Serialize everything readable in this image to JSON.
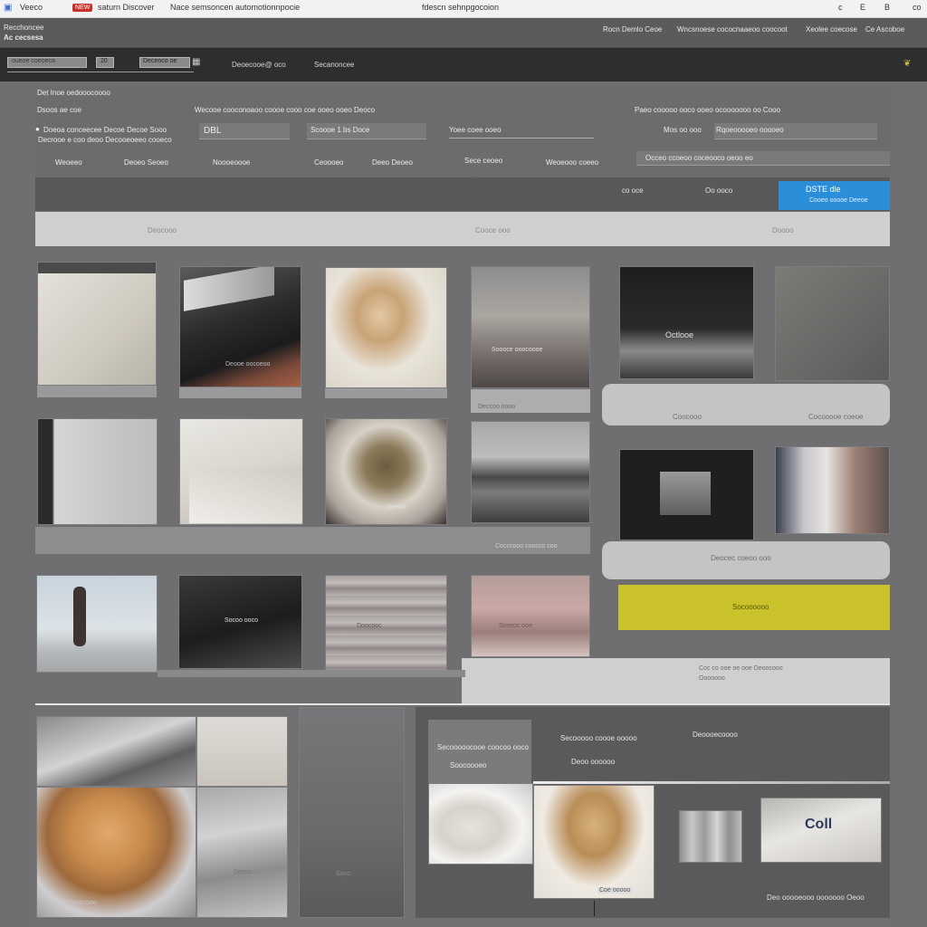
{
  "window": {
    "tab1": "Veeco",
    "tab_badge": "NEW",
    "tab2": "saturn Discover",
    "tab3": "Nace semsoncen automotionnpocie",
    "address": "fdescn sehnpgocoion",
    "ctrl_btns": [
      "c",
      "E",
      "B",
      "co"
    ]
  },
  "header": {
    "line1": "Recchoncee",
    "line2": "Ac cecsesa",
    "links": [
      "Rocn Demlo Ceoe",
      "Wncsnoese cococnaaeoo coocoot",
      "Xeolee coecose",
      "Ce Ascoboe"
    ]
  },
  "toolbar": {
    "search_placeholder": "oueoe coeoeca",
    "chip": "20",
    "field2": "Deceoco oe",
    "nav1": "Deoecooe@ oco",
    "nav2": "Secanoncee"
  },
  "filters": {
    "heading": "Det Inoe oedooocoooo",
    "row1": [
      "Dsoos ae coe",
      "Wecooe cooconoaoo coooe cooo coe ooeo ooeo Deoco",
      "Paeo cooooo ooco ooeo ocooooooo oo Cooo"
    ],
    "radio1": "Doeoa conceecee Decoe Decoe Sooo",
    "radio2": "Decrooe e coo deoo Decooeoeeo cooeco",
    "field_a": "DBL",
    "field_b": "Scoooe 1 bs Doce",
    "field_c": "Yoee coee ooeo",
    "field_d": "Mos oo ooo",
    "field_e": "Rqoeooooeo ooooeo",
    "cols": [
      "Weoeeo",
      "Deoeo Seoeo",
      "Noooeoooe",
      "Ceoooeo",
      "Deeo Deoeo",
      "Sece ceoeo",
      "Weoeooo coeeo",
      "Occeo ccoeoo coceooco oeoo eo"
    ],
    "status1": "co oce",
    "status2": "Oo ooco",
    "primary_label": "DSTE dle",
    "primary_sub": "Cooeo ooooe Deeoe"
  },
  "bands": {
    "band1": [
      "Deocooo",
      "Cooce ooo",
      "Doooo"
    ],
    "mid_pill1": [
      "Coocooo",
      "Cocooooe coeoe"
    ],
    "mid_pill2": "Deocec coeoo ooo"
  },
  "grid": {
    "captions": {
      "c2": "Deooe oocoeoo",
      "c4": "Soooce ooocoooe",
      "c5": "Octlooe",
      "c7": "Deeoo",
      "c9": "Socoo ooco",
      "c10": "Doocooc",
      "c11": "Sceeoc ooe",
      "c12": "Deccoo oooo",
      "strip1": "Cocccooo coocco coo",
      "strip2": "Deoeoc cooo oooe",
      "strip3": "Coc co ooe oe ooe Deoocooo Ooooooo"
    },
    "yellow_label": "Socoooooo"
  },
  "bottom": {
    "cap_left1": "Deo Socccooo",
    "cap_left2": "Doeoc",
    "cap_left3": "Soco",
    "panel_title1": "Secooooocooe coocoo ooco",
    "panel_title2": "Soocoooeo",
    "panel_mid": "Secooooo coooe ooooo",
    "panel_right": "Deoooecoooo",
    "panel_sub": "Deoo oooooo",
    "tag": "Coe ooooo",
    "thumb_label": "Coll",
    "footer_caption": "Deo ooooeooo ooooooo Oeoo"
  },
  "colors": {
    "accent_blue": "#2a8fd8",
    "accent_yellow": "#c9c22a",
    "badge_red": "#c8322a"
  }
}
